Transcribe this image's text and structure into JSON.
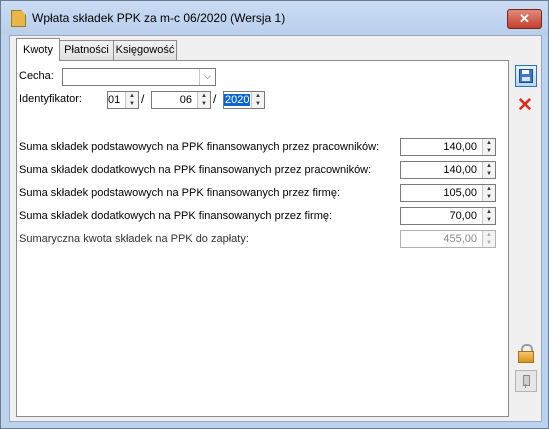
{
  "window": {
    "title": "Wpłata składek PPK za m-c  06/2020 (Wersja 1)",
    "close_label": "✕"
  },
  "tabs": [
    {
      "label": "Kwoty",
      "active": true
    },
    {
      "label": "Płatności",
      "active": false
    },
    {
      "label": "Księgowość",
      "active": false
    }
  ],
  "form": {
    "cecha_label": "Cecha:",
    "cecha_value": "",
    "identyfikator_label": "Identyfikator:",
    "id_day": "01",
    "id_month": "06",
    "id_year": "2020",
    "separator": "/"
  },
  "amounts": [
    {
      "label": "Suma składek podstawowych na PPK finansowanych przez pracowników:",
      "value": "140,00",
      "disabled": false
    },
    {
      "label": "Suma składek dodatkowych na PPK finansowanych przez pracowników:",
      "value": "140,00",
      "disabled": false
    },
    {
      "label": "Suma składek podstawowych na PPK finansowanych przez firmę:",
      "value": "105,00",
      "disabled": false
    },
    {
      "label": "Suma składek dodatkowych na PPK finansowanych przez firmę:",
      "value": "70,00",
      "disabled": false
    },
    {
      "label": "Sumaryczna kwota składek na PPK do zapłaty:",
      "value": "455,00",
      "disabled": true
    }
  ],
  "icons": {
    "title": "document-icon",
    "save": "save-disk-icon",
    "delete": "delete-x-icon",
    "lock": "padlock-icon",
    "pin": "pin-icon"
  },
  "colors": {
    "frame": "#bcd3ee",
    "close_button": "#c2402e",
    "selection": "#0a64d6",
    "delete_icon": "#e02a1f"
  }
}
